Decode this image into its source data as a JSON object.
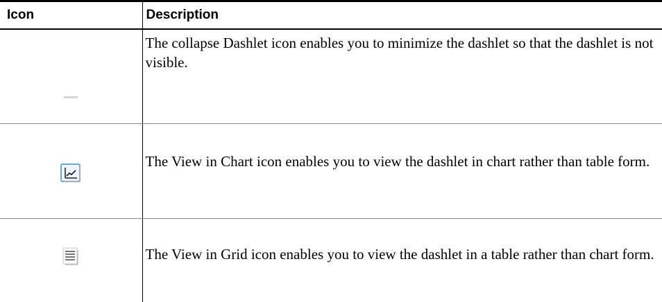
{
  "table": {
    "headers": {
      "icon": "Icon",
      "description": "Description"
    },
    "rows": [
      {
        "icon_name": "collapse-dashlet-icon",
        "description": "The collapse Dashlet icon enables you to minimize the dashlet so that the dashlet is not visible."
      },
      {
        "icon_name": "view-in-chart-icon",
        "description": "The View in Chart icon enables you to view the dashlet in chart rather than table form."
      },
      {
        "icon_name": "view-in-grid-icon",
        "description": "The View in Grid icon enables you to view the dashlet in a table rather than chart form."
      }
    ]
  },
  "colors": {
    "rule": "#000000",
    "row_divider": "#888888",
    "chart_icon_accent": "#3b8fd8",
    "collapse_icon": "#d6d6d6"
  }
}
